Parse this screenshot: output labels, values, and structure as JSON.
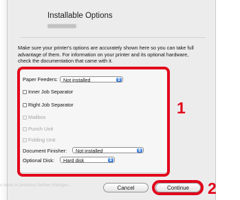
{
  "dialog": {
    "title": "Installable Options",
    "info_text": "Make sure your printer's options are accurately shown here so you can take full advantage of them.  For information on your printer and its optional hardware, check the documentation that came with it."
  },
  "options": {
    "paper_feeders": {
      "label": "Paper Feeders:",
      "value": "Not installed"
    },
    "checkboxes": [
      {
        "label": "Inner Job Separator",
        "checked": false,
        "enabled": true
      },
      {
        "label": "Right Job Separator",
        "checked": false,
        "enabled": true
      },
      {
        "label": "Mailbox",
        "checked": false,
        "enabled": false
      },
      {
        "label": "Punch Unit",
        "checked": false,
        "enabled": false
      },
      {
        "label": "Folding Unit",
        "checked": false,
        "enabled": false
      }
    ],
    "document_finisher": {
      "label": "Document Finisher:",
      "value": "Not installed"
    },
    "optional_disk": {
      "label": "Optional Disk:",
      "value": "Hard disk"
    }
  },
  "footer": {
    "hint_text": "o back to previous further changes.",
    "cancel_label": "Cancel",
    "continue_label": "Continue"
  },
  "callouts": {
    "one": "1",
    "two": "2"
  },
  "colors": {
    "callout": "#e2001a",
    "stepper": "#2e6fd2"
  }
}
